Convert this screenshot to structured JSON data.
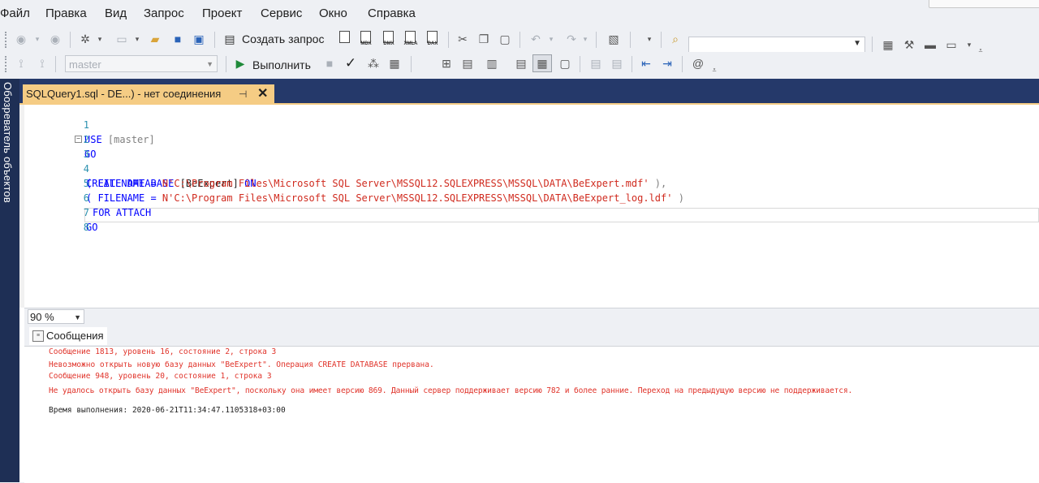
{
  "menu": {
    "items": [
      "Файл",
      "Правка",
      "Вид",
      "Запрос",
      "Проект",
      "Сервис",
      "Окно",
      "Справка"
    ]
  },
  "toolbar": {
    "new_query_label": "Создать запрос",
    "doc_icons": [
      "MDX",
      "DMX",
      "XMLA",
      "DAX"
    ],
    "execute_label": "Выполнить",
    "database_value": "master"
  },
  "side_panel": {
    "object_explorer_label": "Обозреватель объектов"
  },
  "tab": {
    "title": "SQLQuery1.sql - DE...) - нет соединения"
  },
  "editor": {
    "line_numbers": [
      "1",
      "2",
      "3",
      "4",
      "5",
      "6",
      "7",
      "8"
    ],
    "lines": {
      "l1_kw": "USE",
      "l1_rest": "[master]",
      "l2_kw": "GO",
      "l3_kw1": "CREATE DATABASE",
      "l3_ident": "[BeExpert]",
      "l3_kw2": "ON",
      "l4_open": "( FILENAME = ",
      "l4_str": "N'C:\\Program Files\\Microsoft SQL Server\\MSSQL12.SQLEXPRESS\\MSSQL\\DATA\\BeExpert.mdf'",
      "l4_close": " ),",
      "l5_open": "( FILENAME = ",
      "l5_str": "N'C:\\Program Files\\Microsoft SQL Server\\MSSQL12.SQLEXPRESS\\MSSQL\\DATA\\BeExpert_log.ldf'",
      "l5_close": " )",
      "l6_kw": "FOR ATTACH",
      "l7_kw": "GO"
    }
  },
  "zoom": {
    "value": "90 %"
  },
  "results": {
    "messages_tab_label": "Сообщения",
    "error_lines": [
      "Сообщение 1813, уровень 16, состояние 2, строка 3",
      "Невозможно открыть новую базу данных \"BeExpert\". Операция CREATE DATABASE прервана.",
      "Сообщение 948, уровень 20, состояние 1, строка 3",
      "Не удалось открыть базу данных \"BeExpert\", поскольку она имеет версию 869. Данный сервер поддерживает версию 782 и более ранние. Переход на предыдущую версию не поддерживается."
    ],
    "completion_time": "Время выполнения: 2020-06-21T11:34:47.1105318+03:00"
  },
  "colors": {
    "keyword": "#0000ff",
    "string": "#d02b1f",
    "error_text": "#e0332a",
    "tab_active": "#f5cc84",
    "tab_strip": "#25396a",
    "side_panel": "#1e2f55"
  }
}
